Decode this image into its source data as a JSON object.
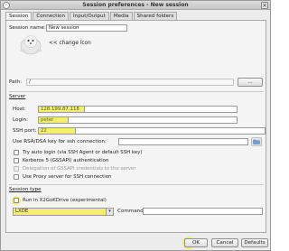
{
  "window": {
    "title": "Session preferences - New session",
    "close_glyph": "×"
  },
  "tabs": [
    {
      "label": "Session"
    },
    {
      "label": "Connection"
    },
    {
      "label": "Input/Output"
    },
    {
      "label": "Media"
    },
    {
      "label": "Shared folders"
    }
  ],
  "session_name": {
    "label": "Session name:",
    "value": "New session"
  },
  "icon": {
    "change_label": "<< change icon"
  },
  "path": {
    "label": "Path:",
    "value": "/",
    "browse_label": "..."
  },
  "server": {
    "title": "Server",
    "host": {
      "label": "Host:",
      "value": "128.199.87.118"
    },
    "login": {
      "label": "Login:",
      "value": "peter"
    },
    "ssh_port": {
      "label": "SSH port:",
      "value": "22"
    },
    "rsa_key": {
      "label": "Use RSA/DSA key for ssh connection:",
      "value": ""
    },
    "options": [
      {
        "label": "Try auto login (via SSH Agent or default SSH key)",
        "disabled": false
      },
      {
        "label": "Kerberos 5 (GSSAPI) authentication",
        "disabled": false
      },
      {
        "label": "Delegation of GSSAPI credentials to the server",
        "disabled": true
      },
      {
        "label": "Use Proxy server for SSH connection",
        "disabled": false
      }
    ]
  },
  "session_type": {
    "title": "Session type",
    "run_in_x2go": {
      "label": "Run in X2GoKDrive (experimental)"
    },
    "type_value": "LXDE",
    "command_label": "Command:",
    "command_value": ""
  },
  "buttons": {
    "ok": "OK",
    "cancel": "Cancel",
    "defaults": "Defaults"
  },
  "colors": {
    "highlight": "#f5ee6a",
    "window_bg": "#ececec",
    "panel_bg": "#f4f4f4"
  }
}
